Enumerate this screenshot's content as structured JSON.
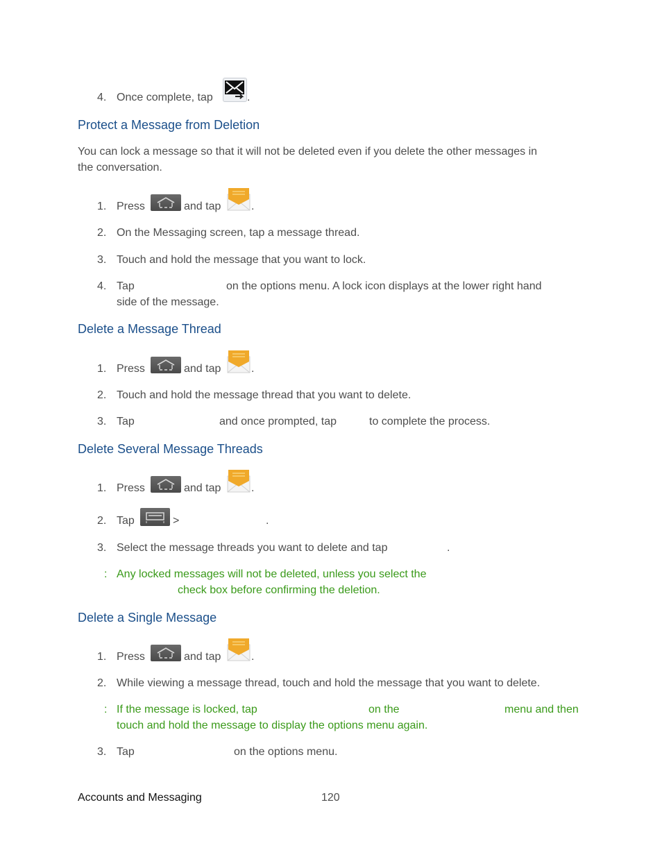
{
  "icons": {
    "send": "send-message-icon",
    "home": "home-key-icon",
    "messaging": "messaging-envelope-icon",
    "menu": "menu-key-icon"
  },
  "colors": {
    "heading": "#1b4f8a",
    "body": "#4d4d4d",
    "note": "#3a9a1a"
  },
  "intro_step": {
    "num": "4.",
    "text": "Once complete, tap",
    "end": "."
  },
  "sections": [
    {
      "title": "Protect a Message from Deletion",
      "para": [
        "You can lock a message so that it will not be deleted even if you delete the other messages in",
        "the conversation."
      ],
      "steps": [
        {
          "num": "1.",
          "press": "Press",
          "and_tap": "and tap",
          "end": "."
        },
        {
          "num": "2.",
          "text": "On the Messaging screen, tap a message thread."
        },
        {
          "num": "3.",
          "text": "Touch and hold the message that you want to lock."
        },
        {
          "num": "4.",
          "tap": "Tap",
          "text": "on the options menu. A lock icon displays at the lower right hand",
          "cont": "side of the message."
        }
      ]
    },
    {
      "title": "Delete a Message Thread",
      "steps": [
        {
          "num": "1.",
          "press": "Press",
          "and_tap": "and tap",
          "end": "."
        },
        {
          "num": "2.",
          "text": "Touch and hold the message thread that you want to delete."
        },
        {
          "num": "3.",
          "tap": "Tap",
          "mid": "and once prompted, tap",
          "text": "to complete the process."
        }
      ]
    },
    {
      "title": "Delete Several Message Threads",
      "steps": [
        {
          "num": "1.",
          "press": "Press",
          "and_tap": "and tap",
          "end": "."
        },
        {
          "num": "2.",
          "tap": "Tap",
          "gt": ">",
          "end": "."
        },
        {
          "num": "3.",
          "text": "Select the message threads you want to delete and tap",
          "end": "."
        }
      ],
      "note": {
        "colon": ":",
        "line1": "Any locked messages will not be deleted, unless you select the",
        "line2": "check box before confirming the deletion."
      }
    },
    {
      "title": "Delete a Single Message",
      "steps": [
        {
          "num": "1.",
          "press": "Press",
          "and_tap": "and tap",
          "end": "."
        },
        {
          "num": "2.",
          "text": "While viewing a message thread, touch and hold the message that you want to delete."
        },
        {
          "num": "3.",
          "tap": "Tap",
          "text": "on the options menu."
        }
      ],
      "note": {
        "colon": ":",
        "a": "If the message is locked, tap",
        "b": "on the",
        "c": "menu and then",
        "line2": "touch and hold the message to display the options menu again."
      }
    }
  ],
  "footer": {
    "section": "Accounts and Messaging",
    "page": "120"
  }
}
